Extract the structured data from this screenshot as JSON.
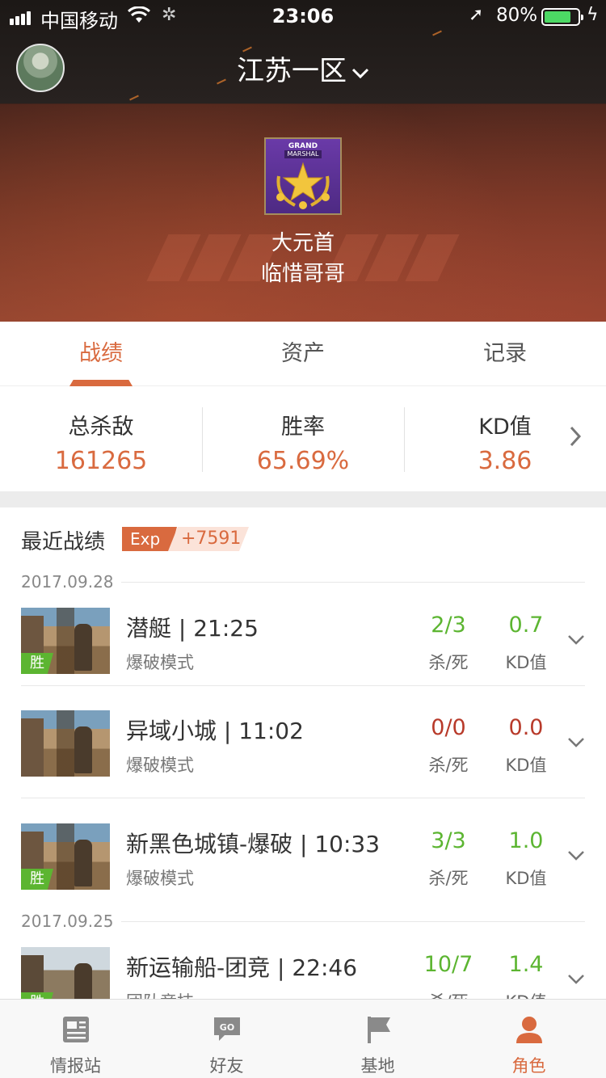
{
  "status_bar": {
    "carrier": "中国移动",
    "time": "23:06",
    "battery_pct": "80%",
    "battery_level": 0.8
  },
  "header": {
    "region": "江苏一区",
    "rank_badge": {
      "line1": "GRAND",
      "line2": "MARSHAL"
    },
    "rank_name": "大元首",
    "player_name": "临惜哥哥"
  },
  "tabs": [
    {
      "label": "战绩",
      "active": true
    },
    {
      "label": "资产",
      "active": false
    },
    {
      "label": "记录",
      "active": false
    }
  ],
  "stats": [
    {
      "label": "总杀敌",
      "value": "161265"
    },
    {
      "label": "胜率",
      "value": "65.69%"
    },
    {
      "label": "KD值",
      "value": "3.86"
    }
  ],
  "recent": {
    "title": "最近战绩",
    "exp_label": "Exp",
    "exp_value": "+7591",
    "kill_death_label": "杀/死",
    "kd_label": "KD值",
    "groups": [
      {
        "date": "2017.09.28",
        "matches": [
          {
            "map": "潜艇 | 21:25",
            "mode": "爆破模式",
            "kills_deaths": "2/3",
            "kd": "0.7",
            "win": true,
            "win_label": "胜",
            "color": "#5cb531"
          },
          {
            "map": "异域小城 | 11:02",
            "mode": "爆破模式",
            "kills_deaths": "0/0",
            "kd": "0.0",
            "win": false,
            "win_label": "",
            "color": "#b83a2a"
          },
          {
            "map": "新黑色城镇-爆破 | 10:33",
            "mode": "爆破模式",
            "kills_deaths": "3/3",
            "kd": "1.0",
            "win": true,
            "win_label": "胜",
            "color": "#5cb531"
          }
        ]
      },
      {
        "date": "2017.09.25",
        "matches": [
          {
            "map": "新运输船-团竞 | 22:46",
            "mode": "团队竞技",
            "kills_deaths": "10/7",
            "kd": "1.4",
            "win": true,
            "win_label": "胜",
            "color": "#5cb531"
          }
        ]
      }
    ]
  },
  "tabbar": [
    {
      "label": "情报站",
      "icon": "newspaper-icon",
      "active": false
    },
    {
      "label": "好友",
      "icon": "go-chat-icon",
      "active": false
    },
    {
      "label": "基地",
      "icon": "flag-icon",
      "active": false
    },
    {
      "label": "角色",
      "icon": "person-icon",
      "active": true
    }
  ],
  "colors": {
    "accent": "#d96a3f",
    "win_green": "#5cb531",
    "loss_red": "#b83a2a"
  }
}
